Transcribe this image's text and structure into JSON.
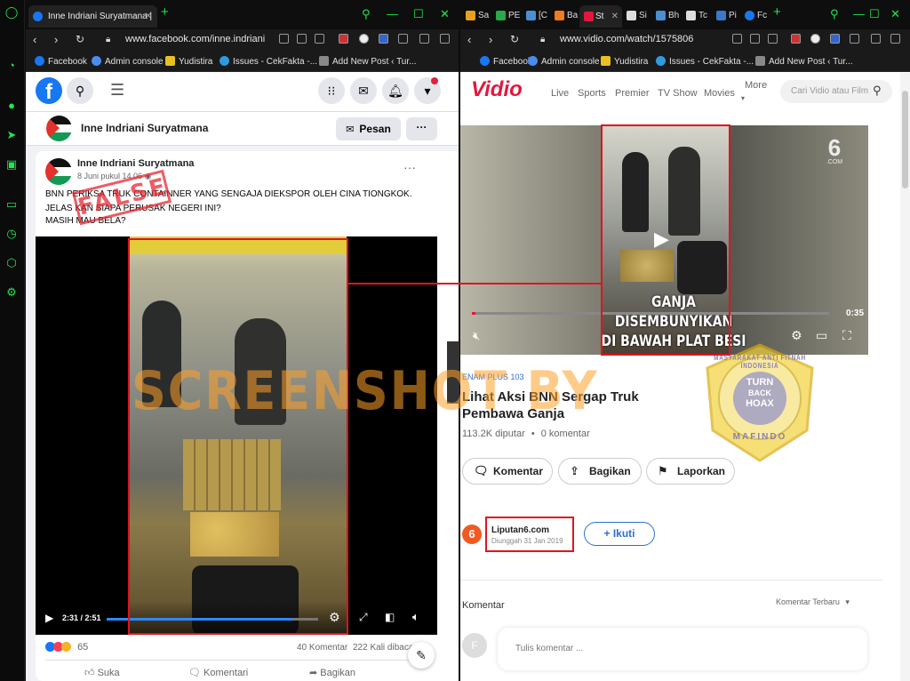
{
  "left_browser": {
    "tab_title": "Inne Indriani Suryatmana |",
    "url": "www.facebook.com/inne.indriani",
    "bookmarks": [
      "Facebook",
      "Admin console",
      "Yudistira",
      "Issues - CekFakta -...",
      "Add New Post ‹ Tur..."
    ]
  },
  "right_browser": {
    "tabs": [
      "Sa",
      "PE",
      "[C",
      "Ba",
      "St",
      "Si",
      "Bh",
      "Tc",
      "Pi",
      "Fc"
    ],
    "url": "www.vidio.com/watch/1575806",
    "bookmarks": [
      "Facebook",
      "Admin console",
      "Yudistira",
      "Issues - CekFakta -...",
      "Add New Post ‹ Tur..."
    ]
  },
  "facebook": {
    "profile_name": "Inne Indriani Suryatmana",
    "message_button": "Pesan",
    "more_button": "···",
    "post": {
      "author": "Inne Indriani Suryatmana",
      "date": "8 Juni pukul 14.06",
      "text_lines": [
        "BNN PERIKSA TRUK CONTAINNER YANG SENGAJA DIEKSPOR OLEH CINA TIONGKOK.",
        "JELAS KAN SIAPA PERUSAK NEGERI INI?",
        "MASIH MAU BELA?"
      ],
      "stamp": "FALSE",
      "video_time": "2:31 / 2:51",
      "video_progress": 0.88,
      "reaction_count": "65",
      "comments": "40 Komentar",
      "views": "222 Kali dibaca",
      "actions": [
        "Suka",
        "Komentari",
        "Bagikan"
      ]
    }
  },
  "watermark_text": "SCREENSHOT BY",
  "vidio": {
    "logo": "Vidio",
    "nav": [
      "Live",
      "Sports",
      "Premier",
      "TV Show",
      "Movies",
      "More"
    ],
    "search_placeholder": "Cari Vidio atau Film",
    "video": {
      "caption_line1": "GANJA DISEMBUNYIKAN",
      "caption_line2": "DI BAWAH PLAT BESI",
      "duration": "0:35",
      "channel_logo": "6",
      "channel_logo_sub": ".COM"
    },
    "category": "ENAM PLUS 103",
    "title": "Lihat Aksi BNN Sergap Truk Pembawa Ganja",
    "views": "113.2K diputar",
    "comment_count": "0 komentar",
    "actions": [
      "Komentar",
      "Bagikan",
      "Laporkan"
    ],
    "uploader": {
      "name": "Liputan6.com",
      "date": "Diunggah 31 Jan 2019",
      "follow": "Ikuti"
    },
    "comments_label": "Komentar",
    "comments_sort": "Komentar Terbaru",
    "comment_placeholder": "Tulis komentar ...",
    "commenter_initial": "F"
  },
  "badge": {
    "ring_text": "MASYARAKAT ANTI FITNAH INDONESIA",
    "center_line1": "TURN",
    "center_line2": "BACK",
    "center_line3": "HOAX",
    "bottom": "MAFINDO"
  },
  "colors": {
    "facebook_blue": "#1877f2",
    "vidio_red": "#e3173e",
    "highlight_red": "#e0141e",
    "opera_green": "#1ee84f"
  }
}
